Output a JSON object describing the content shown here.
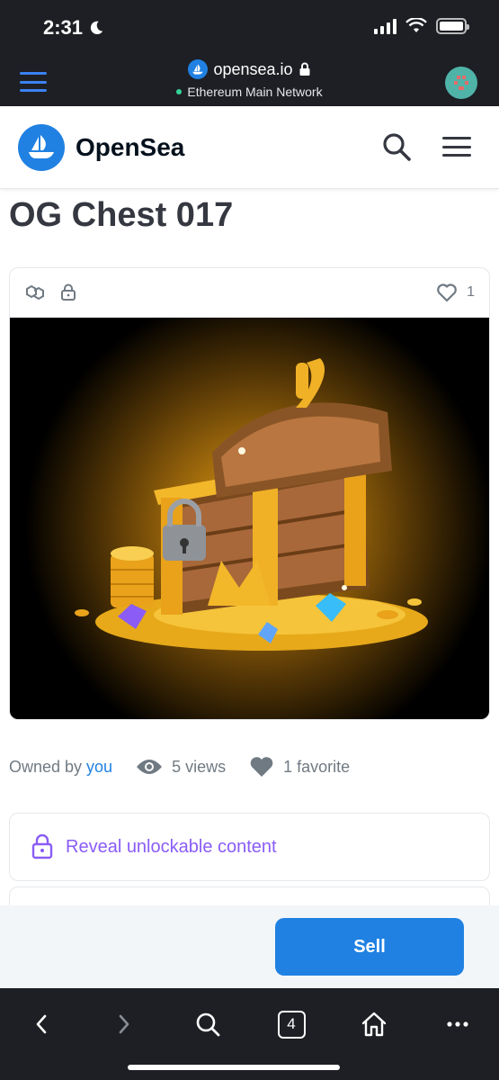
{
  "status_bar": {
    "time": "2:31"
  },
  "browser": {
    "url": "opensea.io",
    "network": "Ethereum Main Network"
  },
  "header": {
    "brand": "OpenSea"
  },
  "item": {
    "title": "OG Chest 017",
    "favorites_count": "1",
    "owned_by_label": "Owned by",
    "owner": "you",
    "views": "5 views",
    "favorites": "1 favorite"
  },
  "actions": {
    "reveal_label": "Reveal unlockable content",
    "sell_label": "Sell"
  },
  "toolbar": {
    "tabs_count": "4"
  },
  "colors": {
    "accent": "#2081e2",
    "reveal": "#8a5cf6",
    "dark_bar": "#1d1f24"
  }
}
